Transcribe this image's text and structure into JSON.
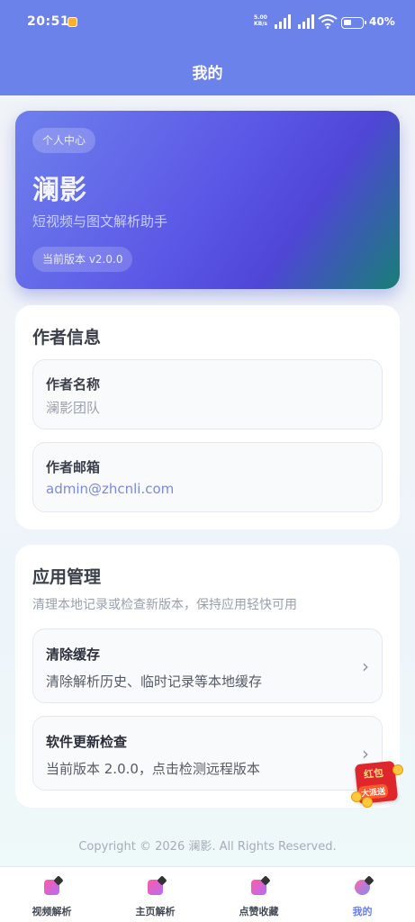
{
  "status_bar": {
    "time": "20:51",
    "net_speed_top": "5.00",
    "net_speed_bottom": "KB/s",
    "sig1_label": "5G",
    "sig2_label": "5G",
    "battery": "40%"
  },
  "header": {
    "title": "我的"
  },
  "hero": {
    "tag": "个人中心",
    "name": "澜影",
    "subtitle": "短视频与图文解析助手",
    "version": "当前版本 v2.0.0"
  },
  "author_card": {
    "title": "作者信息",
    "items": [
      {
        "label": "作者名称",
        "value": "澜影团队"
      },
      {
        "label": "作者邮箱",
        "value": "admin@zhcnli.com"
      }
    ]
  },
  "manage_card": {
    "title": "应用管理",
    "description": "清理本地记录或检查新版本，保持应用轻快可用",
    "actions": [
      {
        "label": "清除缓存",
        "value": "清除解析历史、临时记录等本地缓存"
      },
      {
        "label": "软件更新检查",
        "value": "当前版本 2.0.0，点击检测远程版本"
      }
    ]
  },
  "red_packet": {
    "line1": "红包",
    "line2": "大派送"
  },
  "footer": {
    "copyright": "Copyright © 2026 澜影. All Rights Reserved."
  },
  "tabbar": {
    "tabs": [
      {
        "label": "视频解析",
        "active": false
      },
      {
        "label": "主页解析",
        "active": false
      },
      {
        "label": "点赞收藏",
        "active": false
      },
      {
        "label": "我的",
        "active": true
      }
    ]
  },
  "colors": {
    "header": "#6b82ea",
    "accent": "#6b7ee9",
    "redpacket": "#e0262d"
  }
}
